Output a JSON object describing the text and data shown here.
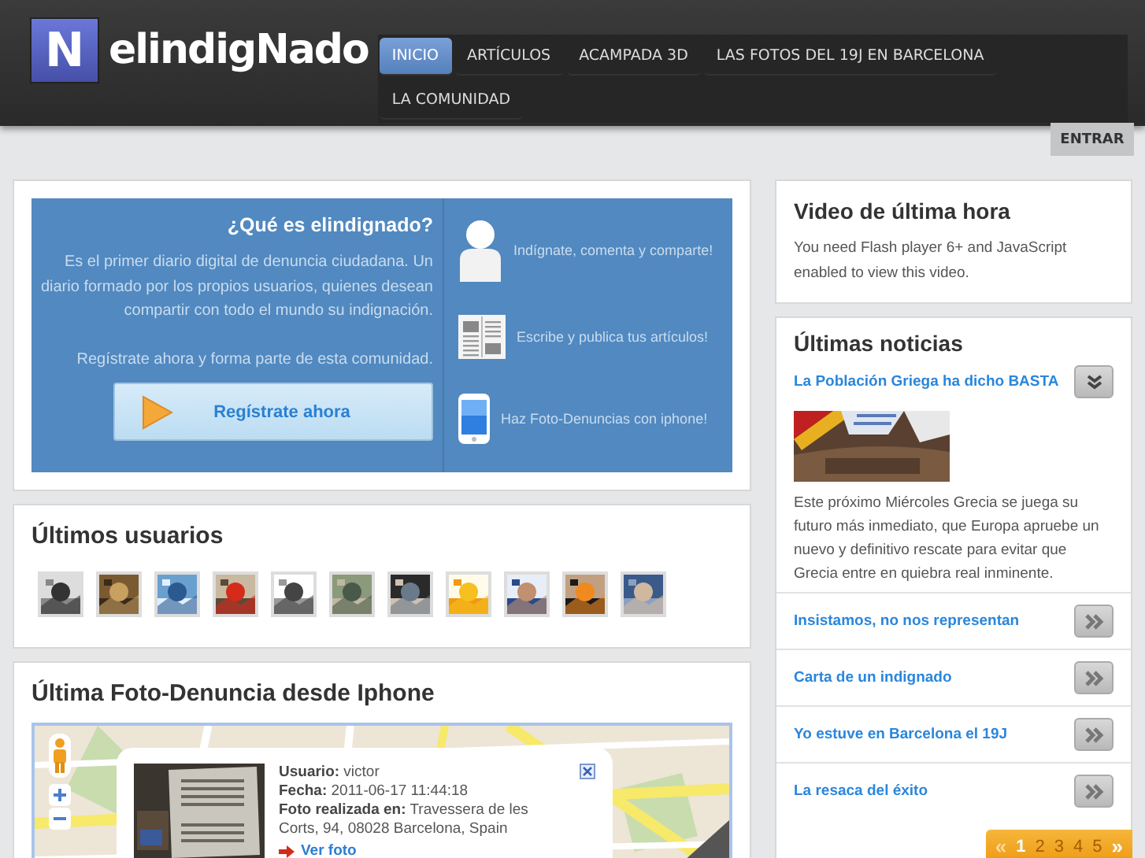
{
  "header": {
    "logo_letter": "N",
    "logo_text": "elindigNado",
    "nav": [
      {
        "label": "INICIO",
        "selected": true
      },
      {
        "label": "ARTÍCULOS",
        "selected": false
      },
      {
        "label": "ACAMPADA 3D",
        "selected": false
      },
      {
        "label": "LAS FOTOS DEL 19J EN BARCELONA",
        "selected": false
      },
      {
        "label": "LA COMUNIDAD",
        "selected": false
      }
    ],
    "login_button": "ENTRAR"
  },
  "intro": {
    "title": "¿Qué es elindignado?",
    "body": "Es el primer diario digital de denuncia ciudadana. Un diario formado por los propios usuarios, quienes desean compartir con todo el mundo su indignación.",
    "cta_text": "Regístrate ahora y forma parte de esta comunidad.",
    "register_button": "Regístrate ahora",
    "features": [
      {
        "kind": "person",
        "label": "Indígnate, comenta y comparte!"
      },
      {
        "kind": "newspaper",
        "label": "Escribe y publica tus artículos!"
      },
      {
        "kind": "phone",
        "label": "Haz Foto-Denuncias con iphone!"
      }
    ]
  },
  "latest_users": {
    "title": "Últimos usuarios"
  },
  "photo_report": {
    "title": "Última Foto-Denuncia desde Iphone",
    "popup": {
      "lines": [
        "**Usuario:** victor",
        "**Fecha:** 2011-06-17 11:44:18",
        "**Foto realizada en:** Travessera de les Corts, 94, 08028 Barcelona, Spain"
      ],
      "link": "Ver foto"
    }
  },
  "video": {
    "title": "Video de última hora",
    "message": "You need Flash player 6+ and JavaScript enabled to view this video."
  },
  "news": {
    "title": "Últimas noticias",
    "items": [
      {
        "title": "La Población Griega ha dicho BASTA",
        "expanded": true,
        "excerpt": "Este próximo Miércoles Grecia se juega su futuro más inmediato, que Europa apruebe un nuevo y definitivo rescate para evitar que Grecia entre en quiebra real inminente."
      },
      {
        "title": "Insistamos, no nos representan",
        "expanded": false
      },
      {
        "title": "Carta de un indignado",
        "expanded": false
      },
      {
        "title": "Yo estuve en Barcelona el 19J",
        "expanded": false
      },
      {
        "title": "La resaca del éxito",
        "expanded": false
      }
    ],
    "pagination": {
      "prev": "«",
      "pages": [
        {
          "label": "1",
          "selected": true
        },
        {
          "label": "2",
          "selected": false
        },
        {
          "label": "3",
          "selected": false
        },
        {
          "label": "4",
          "selected": false
        },
        {
          "label": "5",
          "selected": false
        }
      ],
      "next": "»"
    }
  }
}
